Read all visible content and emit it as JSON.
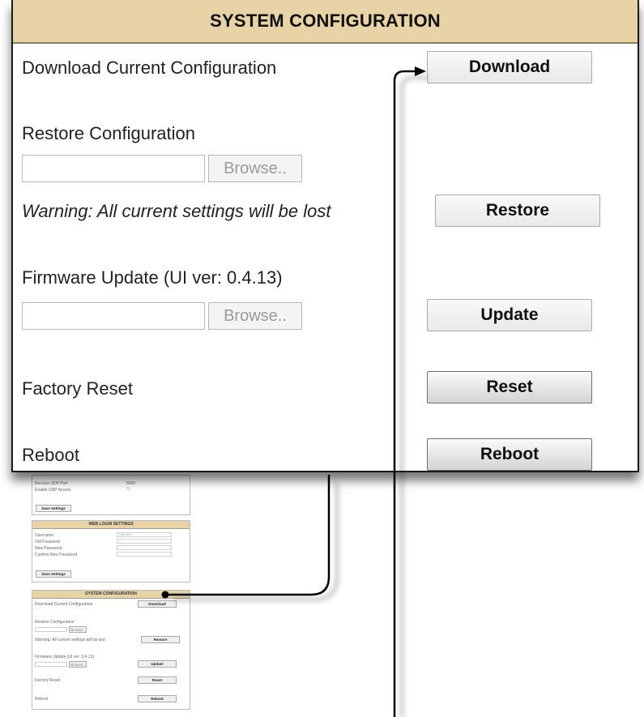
{
  "zoom": {
    "header": "SYSTEM CONFIGURATION",
    "download_label": "Download Current Configuration",
    "download_button": "Download",
    "restore_label": "Restore Configuration",
    "restore_browse": "Browse..",
    "warning": "Warning: All current settings will be lost",
    "restore_button": "Restore",
    "firmware_label": "Firmware Update (UI ver: 0.4.13)",
    "firmware_browse": "Browse..",
    "update_button": "Update",
    "reset_label": "Factory Reset",
    "reset_button": "Reset",
    "reboot_label": "Reboot",
    "reboot_button": "Reboot"
  },
  "thumb": {
    "top_section": {
      "rows": [
        {
          "label": "Receive UDP Port",
          "value": "5000"
        },
        {
          "label": "Enable UDP Access",
          "value": "☐"
        }
      ],
      "save_button": "Save Settings"
    },
    "web_login": {
      "header": "WEB LOGIN SETTINGS",
      "fields": [
        "Username",
        "Old Password",
        "New Password",
        "Confirm New Password"
      ],
      "username_value": "Operator",
      "save_button": "Save Settings"
    },
    "sys_config": {
      "header": "SYSTEM CONFIGURATION",
      "download_label": "Download Current Configuration",
      "download_button": "Download",
      "restore_label": "Restore Configuration",
      "browse": "Browse..",
      "warning": "Warning: All current settings will be lost",
      "restore_button": "Restore",
      "firmware_label": "Firmware Update (UI ver: 0.4.13)",
      "update_button": "Update",
      "reset_label": "Factory Reset",
      "reset_button": "Reset",
      "reboot_label": "Reboot",
      "reboot_button": "Reboot"
    }
  },
  "colors": {
    "header_bg": "#e8d3a6",
    "line": "#000000"
  }
}
